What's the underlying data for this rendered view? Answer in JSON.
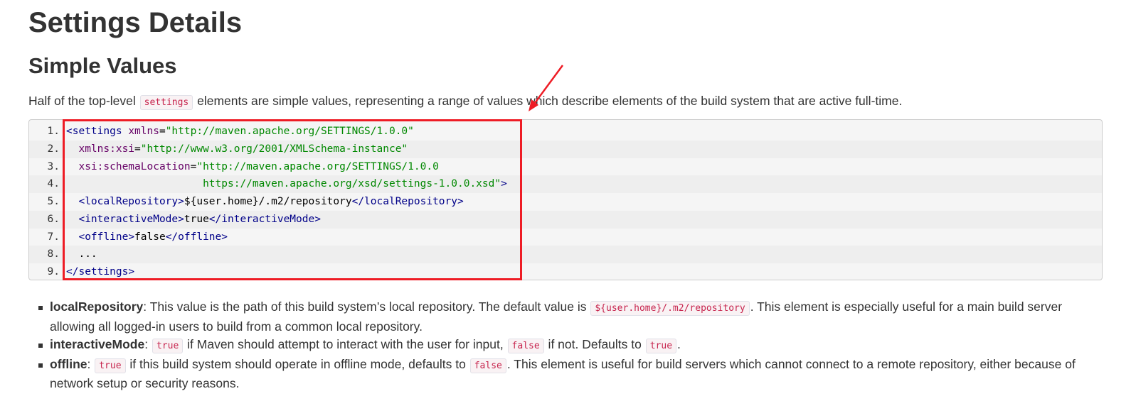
{
  "page": {
    "title": "Settings Details",
    "section_title": "Simple Values",
    "intro": {
      "before": "Half of the top-level ",
      "code": "settings",
      "after": " elements are simple values, representing a range of values which describe elements of the build system that are active full-time."
    }
  },
  "code_block": {
    "lines": [
      {
        "num": "1.",
        "text": "<settings xmlns=\"http://maven.apache.org/SETTINGS/1.0.0\""
      },
      {
        "num": "2.",
        "text": "  xmlns:xsi=\"http://www.w3.org/2001/XMLSchema-instance\""
      },
      {
        "num": "3.",
        "text": "  xsi:schemaLocation=\"http://maven.apache.org/SETTINGS/1.0.0"
      },
      {
        "num": "4.",
        "text": "                      https://maven.apache.org/xsd/settings-1.0.0.xsd\">"
      },
      {
        "num": "5.",
        "text": "  <localRepository>${user.home}/.m2/repository</localRepository>"
      },
      {
        "num": "6.",
        "text": "  <interactiveMode>true</interactiveMode>"
      },
      {
        "num": "7.",
        "text": "  <offline>false</offline>"
      },
      {
        "num": "8.",
        "text": "  ..."
      },
      {
        "num": "9.",
        "text": "</settings>"
      }
    ]
  },
  "details": [
    {
      "term": "localRepository",
      "parts": [
        {
          "t": "text",
          "v": ": This value is the path of this build system’s local repository. The default value is "
        },
        {
          "t": "code",
          "v": "${user.home}/.m2/repository"
        },
        {
          "t": "text",
          "v": ". This element is especially useful for a main build server allowing all logged-in users to build from a common local repository."
        }
      ]
    },
    {
      "term": "interactiveMode",
      "parts": [
        {
          "t": "text",
          "v": ": "
        },
        {
          "t": "code",
          "v": "true"
        },
        {
          "t": "text",
          "v": " if Maven should attempt to interact with the user for input, "
        },
        {
          "t": "code",
          "v": "false"
        },
        {
          "t": "text",
          "v": " if not. Defaults to "
        },
        {
          "t": "code",
          "v": "true"
        },
        {
          "t": "text",
          "v": "."
        }
      ]
    },
    {
      "term": "offline",
      "parts": [
        {
          "t": "text",
          "v": ": "
        },
        {
          "t": "code",
          "v": "true"
        },
        {
          "t": "text",
          "v": " if this build system should operate in offline mode, defaults to "
        },
        {
          "t": "code",
          "v": "false"
        },
        {
          "t": "text",
          "v": ". This element is useful for build servers which cannot connect to a remote repository, either because of network setup or security reasons."
        }
      ]
    }
  ],
  "colors": {
    "annotation": "#ee1c25",
    "tag": "#000088",
    "attribute": "#660066",
    "string": "#008800",
    "inline_code": "#c7254e"
  }
}
